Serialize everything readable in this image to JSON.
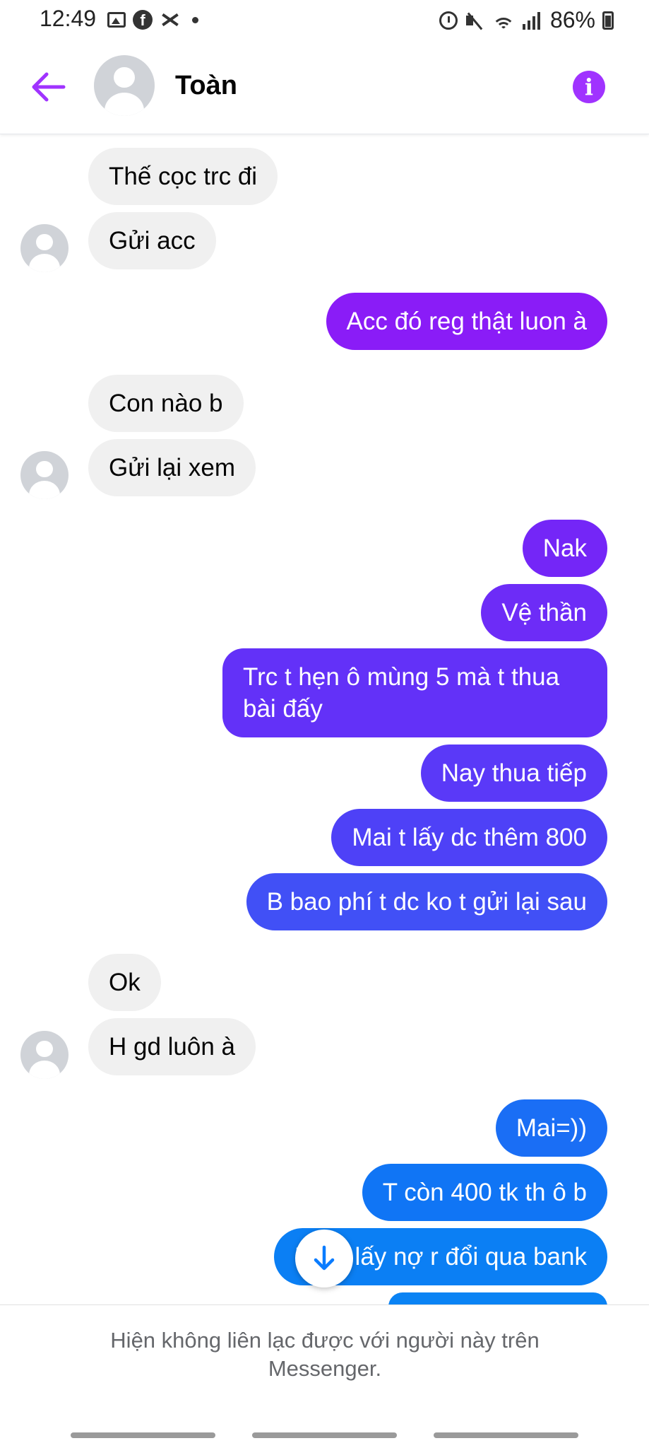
{
  "status_bar": {
    "time": "12:49",
    "battery": "86%",
    "icons_left": [
      "gallery-icon",
      "facebook-icon",
      "capcut-icon",
      "dot-icon"
    ],
    "icons_right": [
      "alarm-icon",
      "mute-icon",
      "wifi-icon",
      "signal-icon",
      "battery-icon"
    ]
  },
  "header": {
    "contact_name": "Toàn",
    "info_glyph": "i"
  },
  "colors": {
    "accent": "#a033ff",
    "incoming_bubble": "#f0f0f0",
    "outgoing_gradient": [
      "#8a1cf7",
      "#5a39f8",
      "#4150f6",
      "#0b7ff4"
    ]
  },
  "messages": [
    {
      "side": "in",
      "text": "Thế cọc trc đi"
    },
    {
      "side": "in",
      "text": "Gửi acc"
    },
    {
      "side": "out",
      "text": "Acc đó reg thật luon à"
    },
    {
      "side": "in",
      "text": "Con nào b"
    },
    {
      "side": "in",
      "text": "Gửi lại xem"
    },
    {
      "side": "out",
      "text": "Nak"
    },
    {
      "side": "out",
      "text": "Vệ thần"
    },
    {
      "side": "out",
      "text": "Trc t hẹn ô mùng 5 mà t thua bài đấy"
    },
    {
      "side": "out",
      "text": "Nay thua tiếp"
    },
    {
      "side": "out",
      "text": "Mai t lấy dc thêm 800"
    },
    {
      "side": "out",
      "text": "B bao phí t dc ko t gửi lại sau"
    },
    {
      "side": "in",
      "text": "Ok"
    },
    {
      "side": "in",
      "text": "H gd luôn à"
    },
    {
      "side": "out",
      "text": "Mai=))"
    },
    {
      "side": "out",
      "text": "T còn 400 tk th ô b"
    },
    {
      "side": "out",
      "text": "Mai t lấy nợ r đổi qua bank"
    }
  ],
  "footer": {
    "notice": "Hiện không liên lạc được với người này trên Messenger."
  }
}
